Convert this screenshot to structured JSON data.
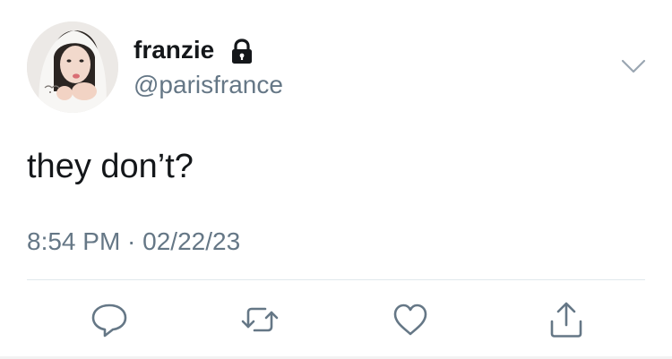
{
  "tweet": {
    "display_name": "franzie",
    "handle": "@parisfrance",
    "text": "they don’t?",
    "timestamp": "8:54 PM · 02/22/23",
    "protected_icon": "lock-icon"
  },
  "actions": {
    "reply_icon": "reply-icon",
    "retweet_icon": "retweet-icon",
    "like_icon": "like-icon",
    "share_icon": "share-icon"
  },
  "colors": {
    "text_primary": "#14171a",
    "text_secondary": "#657786",
    "divider": "#e1e8ed"
  }
}
